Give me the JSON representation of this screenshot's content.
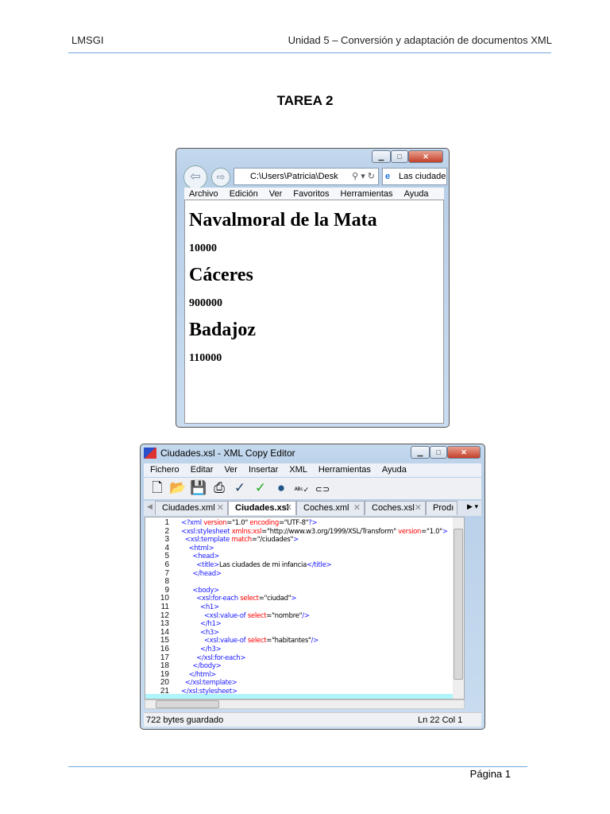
{
  "header": {
    "left": "LMSGI",
    "right": "Unidad 5 – Conversión y adaptación de documentos XML"
  },
  "title": "TAREA 2",
  "browser": {
    "address": "C:\\Users\\Patricia\\Desk",
    "tab": "Las ciudade",
    "menu": [
      "Archivo",
      "Edición",
      "Ver",
      "Favoritos",
      "Herramientas",
      "Ayuda"
    ],
    "content": [
      {
        "name": "Navalmoral de la Mata",
        "value": "10000"
      },
      {
        "name": "Cáceres",
        "value": "900000"
      },
      {
        "name": "Badajoz",
        "value": "110000"
      }
    ]
  },
  "editor": {
    "title": "Ciudades.xsl - XML Copy Editor",
    "menu": [
      "Fichero",
      "Editar",
      "Ver",
      "Insertar",
      "XML",
      "Herramientas",
      "Ayuda"
    ],
    "tabs": [
      "Ciudades.xml",
      "Ciudades.xsl",
      "Coches.xml",
      "Coches.xsl",
      "Prodı"
    ],
    "colors": {
      "tag": "#1a1aff",
      "attr": "#ff0000",
      "text": "#000000"
    },
    "lines": [
      [
        [
          "<?xml ",
          "tag"
        ],
        [
          "version",
          "attr"
        ],
        [
          "=\"1.0\" ",
          "text"
        ],
        [
          "encoding",
          "attr"
        ],
        [
          "=\"UTF-8\"",
          "text"
        ],
        [
          "?>",
          "tag"
        ]
      ],
      [
        [
          "<xsl:stylesheet ",
          "tag"
        ],
        [
          "xmlns:xsl",
          "attr"
        ],
        [
          "=\"http://www.w3.org/1999/XSL/Transform\" ",
          "text"
        ],
        [
          "version",
          "attr"
        ],
        [
          "=\"1.0\"",
          "text"
        ],
        [
          ">",
          "tag"
        ]
      ],
      [
        [
          "  <xsl:template ",
          "tag"
        ],
        [
          "match",
          "attr"
        ],
        [
          "=\"/ciudades\"",
          "text"
        ],
        [
          ">",
          "tag"
        ]
      ],
      [
        [
          "    <html>",
          "tag"
        ]
      ],
      [
        [
          "      <head>",
          "tag"
        ]
      ],
      [
        [
          "        <title>",
          "tag"
        ],
        [
          "Las ciudades de mi infancia",
          "text"
        ],
        [
          "</title>",
          "tag"
        ]
      ],
      [
        [
          "      </head>",
          "tag"
        ]
      ],
      [
        [
          "",
          "text"
        ]
      ],
      [
        [
          "      <body>",
          "tag"
        ]
      ],
      [
        [
          "        <xsl:for-each ",
          "tag"
        ],
        [
          "select",
          "attr"
        ],
        [
          "=\"ciudad\"",
          "text"
        ],
        [
          ">",
          "tag"
        ]
      ],
      [
        [
          "          <h1>",
          "tag"
        ]
      ],
      [
        [
          "            <xsl:value-of ",
          "tag"
        ],
        [
          "select",
          "attr"
        ],
        [
          "=\"nombre\"",
          "text"
        ],
        [
          "/>",
          "tag"
        ]
      ],
      [
        [
          "          </h1>",
          "tag"
        ]
      ],
      [
        [
          "          <h3>",
          "tag"
        ]
      ],
      [
        [
          "            <xsl:value-of ",
          "tag"
        ],
        [
          "select",
          "attr"
        ],
        [
          "=\"habitantes\"",
          "text"
        ],
        [
          "/>",
          "tag"
        ]
      ],
      [
        [
          "          </h3>",
          "tag"
        ]
      ],
      [
        [
          "        </xsl:for-each>",
          "tag"
        ]
      ],
      [
        [
          "      </body>",
          "tag"
        ]
      ],
      [
        [
          "    </html>",
          "tag"
        ]
      ],
      [
        [
          "  </xsl:template>",
          "tag"
        ]
      ],
      [
        [
          "</xsl:stylesheet>",
          "tag"
        ]
      ]
    ],
    "status": {
      "left": "722 bytes guardado",
      "right": "Ln 22 Col 1"
    }
  },
  "footer": {
    "page": "Página 1"
  }
}
